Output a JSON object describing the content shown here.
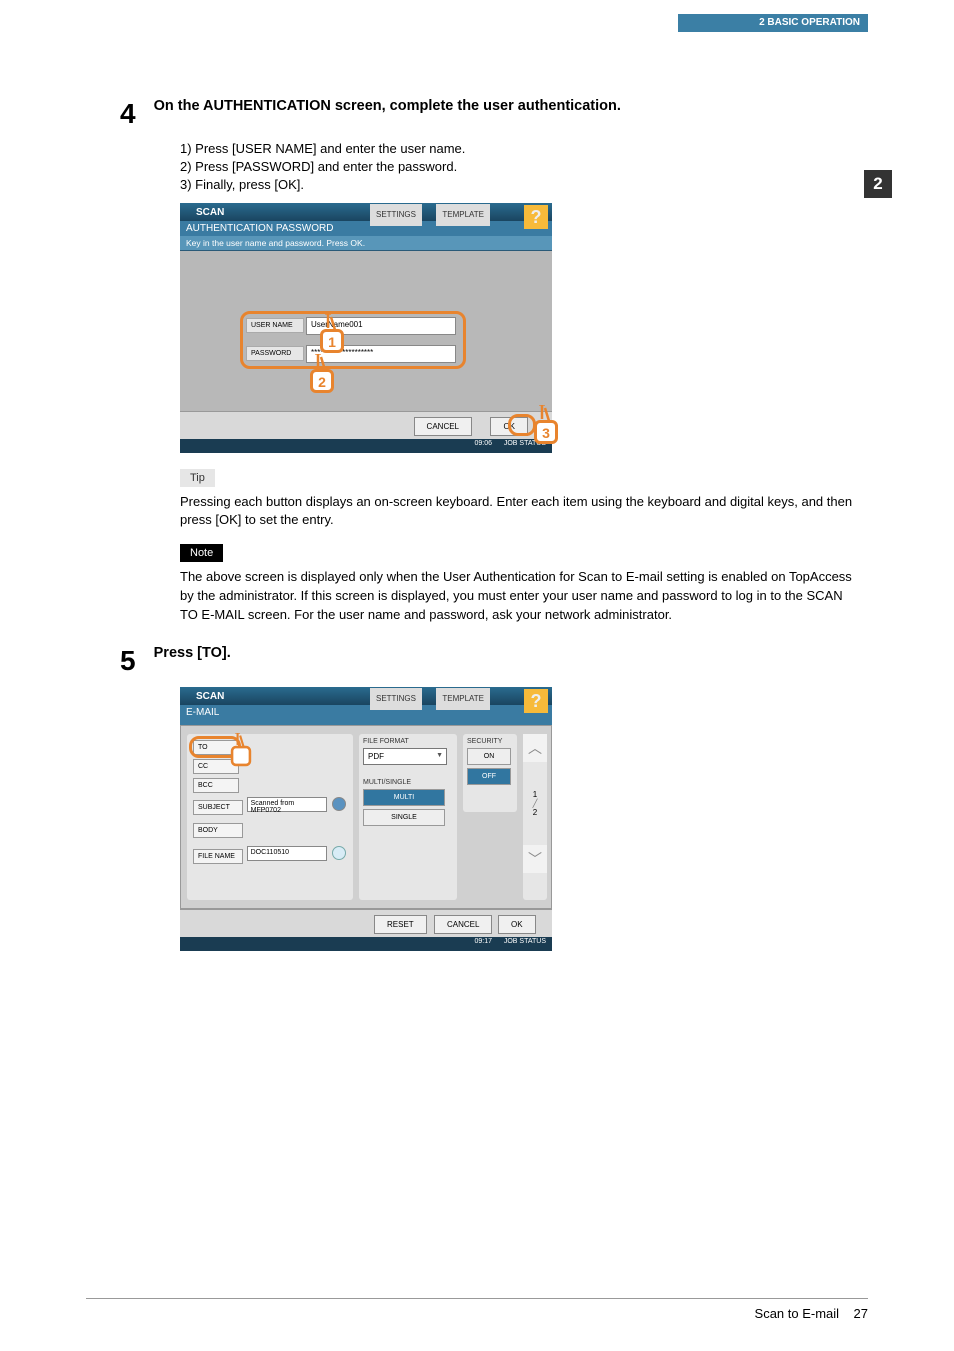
{
  "header": {
    "chapter": "2 BASIC OPERATION",
    "tab": "2"
  },
  "step4": {
    "num": "4",
    "title": "On the AUTHENTICATION screen, complete the user authentication.",
    "list": [
      "1)  Press [USER NAME] and enter the user name.",
      "2)  Press [PASSWORD] and enter the password.",
      "3)  Finally, press [OK]."
    ]
  },
  "ss1": {
    "title": "SCAN",
    "settings_tab": "SETTINGS",
    "template_tab": "TEMPLATE",
    "help": "?",
    "subtitle": "AUTHENTICATION PASSWORD",
    "hint": "Key in the user name and password. Press OK.",
    "username_label": "USER NAME",
    "username_value": "UserName001",
    "password_label": "PASSWORD",
    "password_value": "********************",
    "cancel": "CANCEL",
    "ok": "OK",
    "time": "09:06",
    "jobstatus": "JOB STATUS",
    "marker1": "1",
    "marker2": "2",
    "marker3": "3"
  },
  "tip": {
    "label": "Tip",
    "text": "Pressing each button displays an on-screen keyboard. Enter each item using the keyboard and digital keys, and then press [OK] to set the entry."
  },
  "note": {
    "label": "Note",
    "text": "The above screen is displayed only when the User Authentication for Scan to E-mail setting is enabled on TopAccess by the administrator. If this screen is displayed, you must enter your user name and password to log in to the SCAN TO E-MAIL screen. For the user name and password, ask your network administrator."
  },
  "step5": {
    "num": "5",
    "title": "Press [TO]."
  },
  "ss2": {
    "title": "SCAN",
    "settings_tab": "SETTINGS",
    "template_tab": "TEMPLATE",
    "help": "?",
    "subtitle": "E-MAIL",
    "to": "TO",
    "cc": "CC",
    "bcc": "BCC",
    "subject": "SUBJECT",
    "subject_value": "Scanned from MFP0702",
    "body": "BODY",
    "filename": "FILE NAME",
    "filename_value": "DOC110510",
    "fileformat_label": "FILE FORMAT",
    "fileformat_value": "PDF",
    "multisingle_label": "MULTI/SINGLE",
    "multi": "MULTI",
    "single": "SINGLE",
    "security_label": "SECURITY",
    "on": "ON",
    "off": "OFF",
    "page": "1",
    "pages": "2",
    "reset": "RESET",
    "cancel": "CANCEL",
    "ok": "OK",
    "time": "09:17",
    "jobstatus": "JOB STATUS"
  },
  "footer": {
    "section": "Scan to E-mail",
    "page": "27"
  }
}
